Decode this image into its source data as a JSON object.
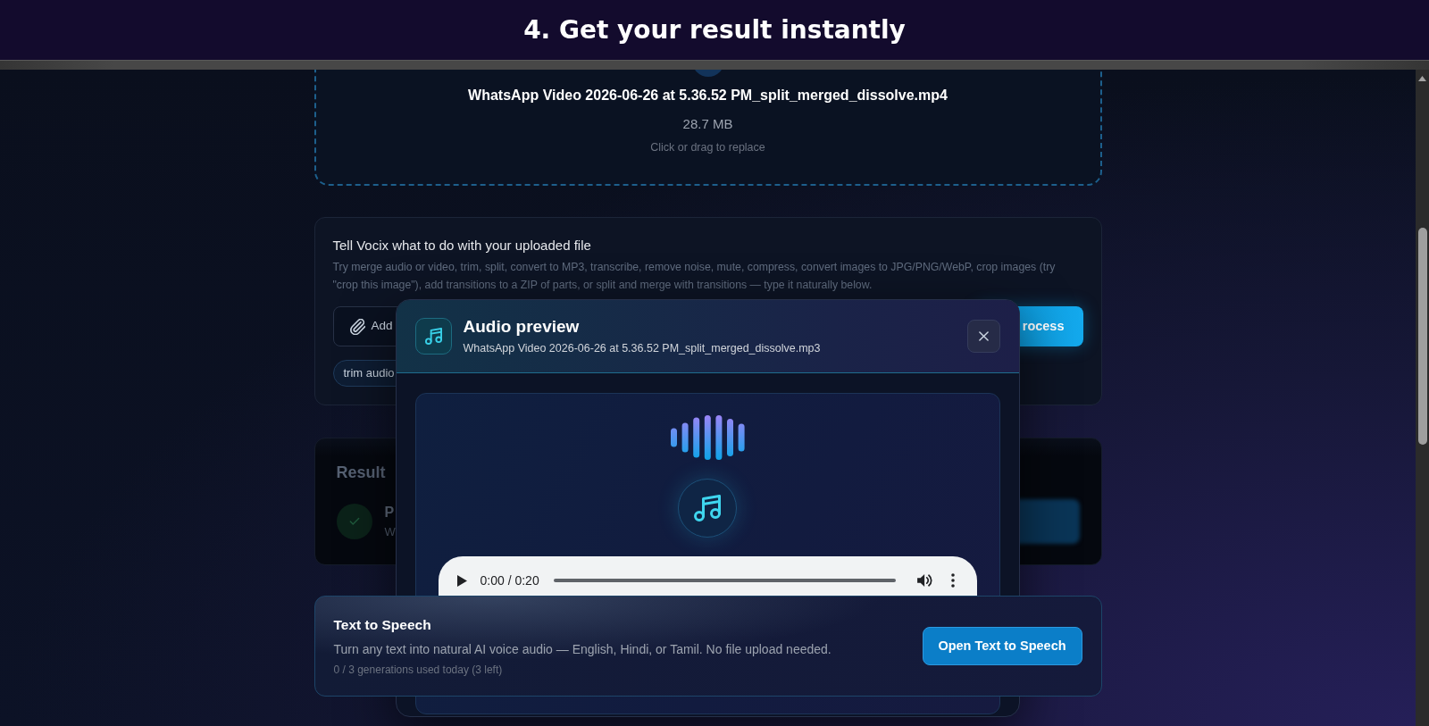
{
  "banner": {
    "title": "4. Get your result instantly"
  },
  "upload_card": {
    "file_name": "WhatsApp Video 2026-06-26 at 5.36.52 PM_split_merged_dissolve.mp4",
    "file_size": "28.7 MB",
    "hint": "Click or drag to replace"
  },
  "prompt_card": {
    "title": "Tell Vocix what to do with your uploaded file",
    "description": "Try merge audio or video, trim, split, convert to MP3, transcribe, remove noise, mute, compress, convert images to JPG/PNG/WebP, crop images (try \"crop this image\"), add transitions to a ZIP of parts, or split and merge with transitions — type it naturally below.",
    "attach_button": "Add",
    "process_button": "rocess",
    "suggestions": [
      "trim audio"
    ]
  },
  "result_card": {
    "title": "Result",
    "item": {
      "title": "P",
      "subtitle": "W"
    }
  },
  "audio_modal": {
    "title": "Audio preview",
    "file_name": "WhatsApp Video 2026-06-26 at 5.36.52 PM_split_merged_dissolve.mp3",
    "player": {
      "time": "0:00 / 0:20"
    }
  },
  "tts_card": {
    "title": "Text to Speech",
    "description": "Turn any text into natural AI voice audio — English, Hindi, or Tamil. No file upload needed.",
    "usage": "0 / 3 generations used today (3 left)",
    "button": "Open Text to Speech"
  }
}
